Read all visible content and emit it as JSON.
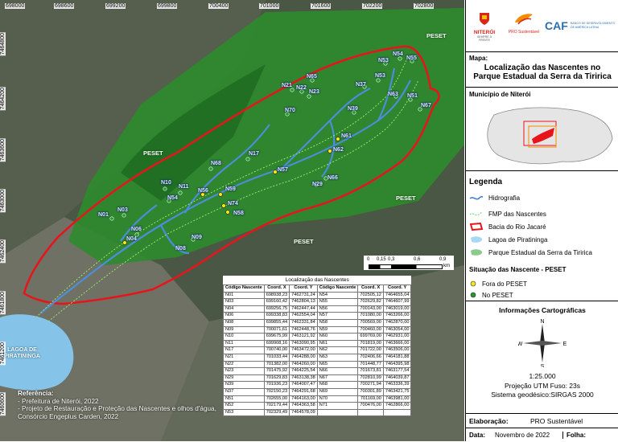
{
  "map": {
    "x_coords": [
      "698000",
      "698600",
      "699200",
      "699800",
      "700400",
      "701000",
      "701600",
      "702200",
      "702800"
    ],
    "y_coords": [
      "7464800",
      "7464200",
      "7463600",
      "7463000",
      "7462400",
      "7461800",
      "7461200",
      "7460600"
    ],
    "peset_labels": [
      "PESET",
      "PESET",
      "PESET",
      "PESET"
    ],
    "lagoa_label_1": "LAGOA DE",
    "lagoa_label_2": "PIRATININGA",
    "references": {
      "heading": "Referência:",
      "line1": "- Prefeitura de Niterói, 2022",
      "line2": "- Projeto de Restauração e Proteção das Nascentes e olhos d'água,",
      "line3": "Consórcio Engeplus Carden, 2022"
    },
    "scale": {
      "t0": "0",
      "t1": "0,15",
      "t2": "0,3",
      "t3": "0,6",
      "t4": "0,9",
      "unit": "km"
    },
    "nascentes_fora": [
      "N04",
      "N56",
      "N59",
      "N74",
      "N58",
      "N57",
      "N61",
      "N62"
    ],
    "nascentes_no": [
      "N01",
      "N03",
      "N06",
      "N08",
      "N09",
      "N10",
      "N11",
      "N17",
      "N21",
      "N22",
      "N23",
      "N29",
      "N37",
      "N39",
      "N51",
      "N53",
      "N54",
      "N55",
      "N60",
      "N63",
      "N65",
      "N66",
      "N67",
      "N68",
      "N70"
    ]
  },
  "table": {
    "title": "Localização das Nascentes",
    "headers": [
      "Código Nascente",
      "Coord. X",
      "Coord. Y",
      "Código Nascente",
      "Coord. X",
      "Coord. Y"
    ],
    "left_rows": [
      [
        "N01",
        "698938,23",
        "7462731,24"
      ],
      [
        "N03",
        "699160,42",
        "7462804,13"
      ],
      [
        "N04",
        "699256,75",
        "7462447,44"
      ],
      [
        "N06",
        "699338,83",
        "7462554,04"
      ],
      [
        "N08",
        "699855,44",
        "7462331,84"
      ],
      [
        "N09",
        "700071,61",
        "7462448,76"
      ],
      [
        "N10",
        "699675,99",
        "7463121,92"
      ],
      [
        "N11",
        "699908,16",
        "7463090,95"
      ],
      [
        "N17",
        "700740,00",
        "7463472,00"
      ],
      [
        "N21",
        "701033,44",
        "7464288,00"
      ],
      [
        "N22",
        "701382,00",
        "7464260,00"
      ],
      [
        "N23",
        "701475,92",
        "7464225,54"
      ],
      [
        "N29",
        "701629,83",
        "7463138,38"
      ],
      [
        "N39",
        "701936,23",
        "7464007,47"
      ],
      [
        "N37",
        "702150,23",
        "7464291,68"
      ],
      [
        "N51",
        "702655,00",
        "7464163,00"
      ],
      [
        "N52",
        "702179,44",
        "7464363,58"
      ],
      [
        "N53",
        "702329,49",
        "7464578,09"
      ]
    ],
    "right_rows": [
      [
        "N54",
        "702505,12",
        "7464655,04"
      ],
      [
        "N55",
        "702629,82",
        "7464607,99"
      ],
      [
        "N56",
        "700143,00",
        "7463019,00"
      ],
      [
        "N57",
        "701080,00",
        "7463266,00"
      ],
      [
        "N58",
        "700569,00",
        "7462870,00"
      ],
      [
        "N59",
        "700460,00",
        "7463054,00"
      ],
      [
        "N60",
        "699769,00",
        "7462931,00"
      ],
      [
        "N61",
        "701819,00",
        "7463666,00"
      ],
      [
        "N62",
        "701722,00",
        "7463506,00"
      ],
      [
        "N63",
        "702406,66",
        "7464181,88"
      ],
      [
        "N65",
        "701448,77",
        "7464395,98"
      ],
      [
        "N66",
        "701673,81",
        "7463177,54"
      ],
      [
        "N67",
        "702810,99",
        "7464039,87"
      ],
      [
        "N68",
        "700271,94",
        "7463336,39"
      ],
      [
        "N69",
        "700301,89",
        "7463421,75"
      ],
      [
        "N70",
        "701169,00",
        "7463981,00"
      ],
      [
        "N71",
        "700476,00",
        "7462866,00"
      ]
    ]
  },
  "panel": {
    "logo_niteroi": "NITERÓI",
    "logo_niteroi_sub": "SEMPRE À FRENTE",
    "logo_pro": "PRO Sustentável",
    "logo_caf": "CAF",
    "logo_caf_sub1": "BANCO DE DESENVOLVIMENTO",
    "logo_caf_sub2": "DE AMÉRICA LATINA",
    "mapa_label": "Mapa:",
    "mapa_title_1": "Localização das Nascentes no",
    "mapa_title_2": "Parque Estadual da Serra da Tiririca",
    "municipio": "Município de Niterói",
    "legenda": "Legenda",
    "legend_items": [
      "Hidrografia",
      "FMP das Nascentes",
      "Bacia do Rio Jacaré",
      "Lagoa de Piratininga",
      "Parque Estadual da Serra da Tiririca"
    ],
    "situacao": "Situação das Nascente - PESET",
    "situacao_items": [
      "Fora do PESET",
      "No PESET"
    ],
    "info_title": "Informações Cartográficas",
    "compass": {
      "n": "N",
      "s": "S",
      "e": "E",
      "w": "W"
    },
    "escala": "1:25.000",
    "projecao": "Projeção UTM  Fuso: 23s",
    "sistema": "Sistema geodésico:SIRGAS 2000",
    "elaboracao_label": "Elaboração:",
    "elaboracao_value": "PRO Sustentável",
    "data_label": "Data:",
    "data_value": "Novembro de 2022",
    "folha_label": "Folha:"
  },
  "colors": {
    "bacia": "#e8141c",
    "park": "#2e8b2e",
    "hidro": "#3a7bd5",
    "fora": "#f7e61c",
    "no": "#1f9a2e"
  }
}
